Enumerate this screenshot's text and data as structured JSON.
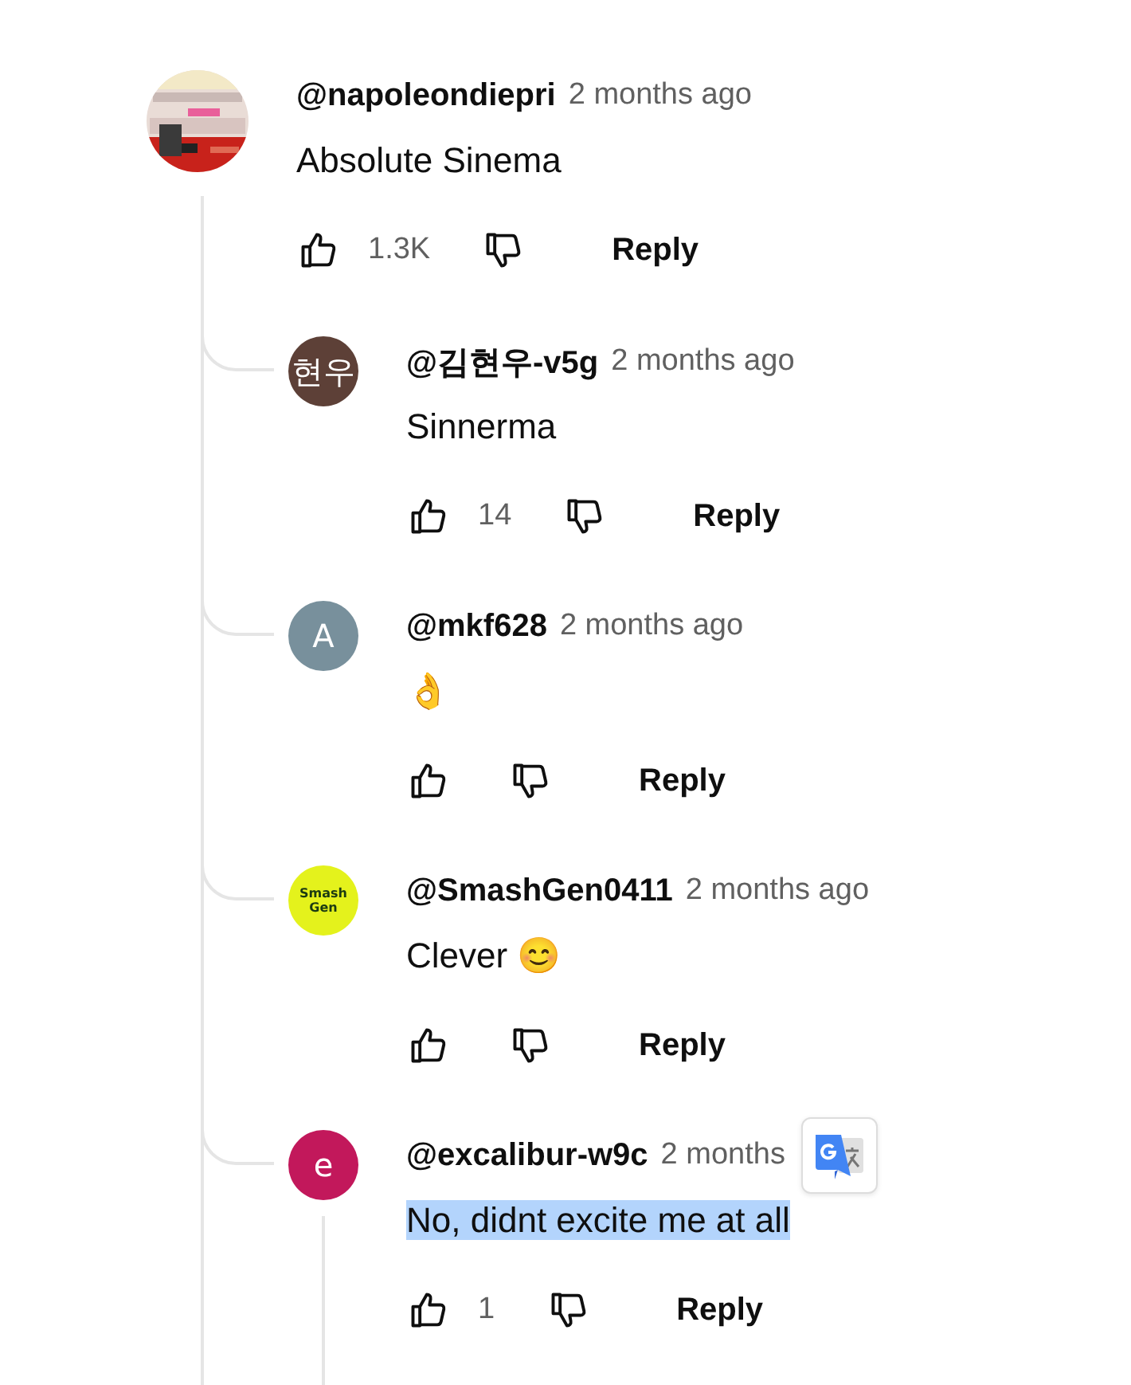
{
  "comment": {
    "author": "@napoleondiepri",
    "time": "2 months ago",
    "text": "Absolute Sinema",
    "likes": "1.3K",
    "reply_label": "Reply"
  },
  "replies": [
    {
      "author": "@김현우-v5g",
      "time": "2 months ago",
      "text": "Sinnerma",
      "likes": "14",
      "reply_label": "Reply",
      "avatar": {
        "kind": "letter",
        "text": "현우",
        "color": "#5d4037"
      },
      "highlighted": false,
      "replies_open": false,
      "translate_popup": false
    },
    {
      "author": "@mkf628",
      "time": "2 months ago",
      "text": "👌",
      "reply_label": "Reply",
      "avatar": {
        "kind": "letter",
        "text": "A",
        "color": "#78909c"
      },
      "highlighted": false,
      "replies_open": false,
      "translate_popup": false
    },
    {
      "author": "@SmashGen0411",
      "time": "2 months ago",
      "text": "Clever 😊",
      "reply_label": "Reply",
      "avatar": {
        "kind": "logo",
        "text": "Smash Gen"
      },
      "highlighted": false,
      "replies_open": false,
      "translate_popup": false
    },
    {
      "author": "@excalibur-w9c",
      "time": "2 months",
      "text": "No, didnt excite me at all",
      "likes": "1",
      "reply_label": "Reply",
      "avatar": {
        "kind": "letter",
        "text": "e",
        "color": "#c2185b"
      },
      "highlighted": true,
      "replies_open": true,
      "translate_popup": true
    }
  ]
}
